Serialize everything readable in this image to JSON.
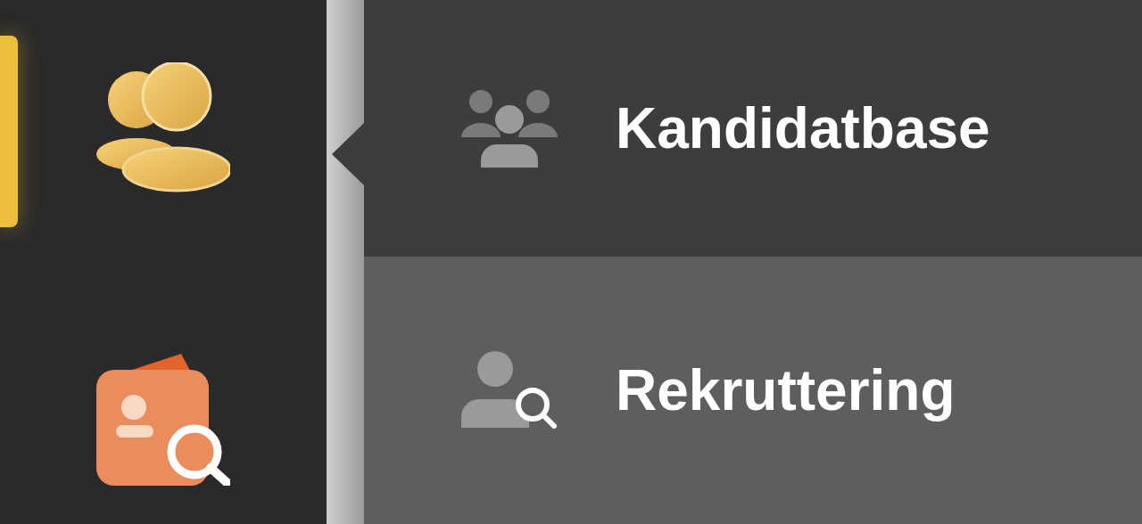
{
  "sidebar": {
    "items": [
      {
        "kind": "coins",
        "selected": true
      },
      {
        "kind": "search",
        "selected": false
      }
    ]
  },
  "menu": {
    "items": [
      {
        "kind": "group",
        "label": "Kandidatbase",
        "selected": true
      },
      {
        "kind": "search",
        "label": "Rekruttering",
        "selected": false
      }
    ]
  }
}
